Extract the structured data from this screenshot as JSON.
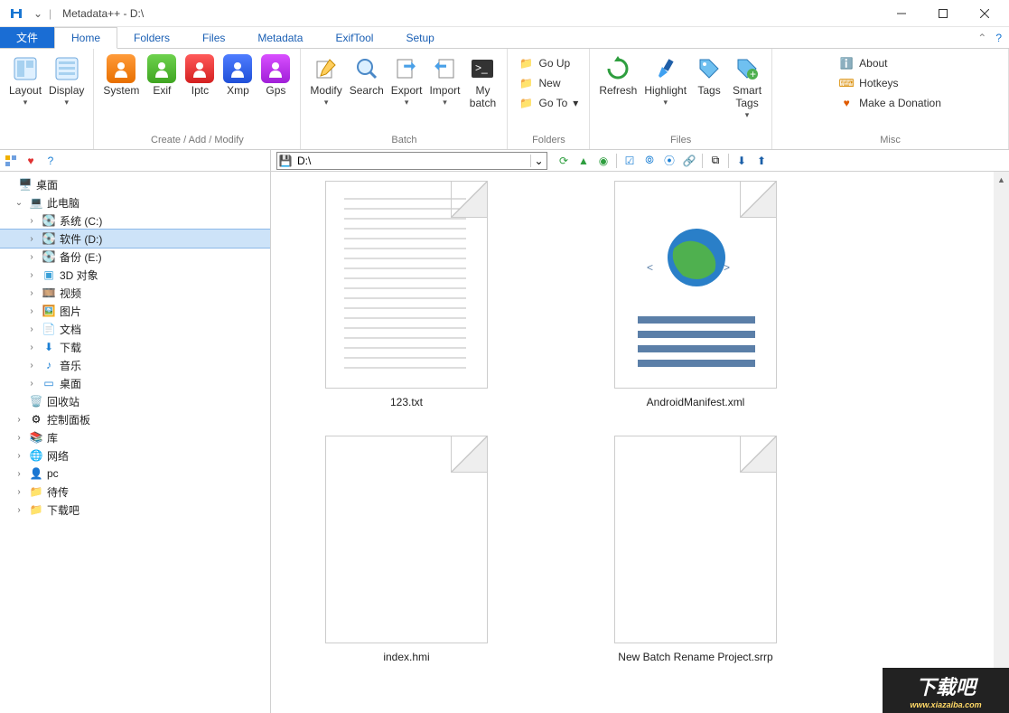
{
  "title": "Metadata++ - D:\\",
  "tabs": {
    "file": "文件",
    "home": "Home",
    "folders": "Folders",
    "files": "Files",
    "metadata": "Metadata",
    "exiftool": "ExifTool",
    "setup": "Setup"
  },
  "ribbon": {
    "g0": {
      "layout": "Layout",
      "display": "Display"
    },
    "g1": {
      "label": "Create / Add / Modify",
      "system": "System",
      "exif": "Exif",
      "iptc": "Iptc",
      "xmp": "Xmp",
      "gps": "Gps"
    },
    "g2": {
      "label": "Batch",
      "modify": "Modify",
      "search": "Search",
      "export": "Export",
      "import": "Import",
      "mybatch": "My\nbatch"
    },
    "g3": {
      "label": "Folders",
      "goup": "Go Up",
      "new": "New",
      "goto": "Go To"
    },
    "g4": {
      "label": "Files",
      "refresh": "Refresh",
      "highlight": "Highlight",
      "tags": "Tags",
      "smarttags": "Smart\nTags"
    },
    "g5": {
      "label": "Misc",
      "about": "About",
      "hotkeys": "Hotkeys",
      "donate": "Make a Donation"
    }
  },
  "path": "D:\\",
  "tree": {
    "desktop": "桌面",
    "thispc": "此电脑",
    "drives": {
      "c": "系统 (C:)",
      "d": "软件 (D:)",
      "e": "备份 (E:)"
    },
    "folders": {
      "obj3d": "3D 对象",
      "video": "视频",
      "pics": "图片",
      "docs": "文档",
      "downloads": "下载",
      "music": "音乐",
      "desk2": "桌面"
    },
    "misc": {
      "recycle": "回收站",
      "control": "控制面板",
      "lib": "库",
      "net": "网络",
      "pc": "pc",
      "pending": "待传",
      "xzb": "下载吧"
    }
  },
  "files": [
    {
      "name": "123.txt",
      "kind": "text"
    },
    {
      "name": "AndroidManifest.xml",
      "kind": "xml"
    },
    {
      "name": "index.hmi",
      "kind": "blank"
    },
    {
      "name": "New Batch Rename Project.srrp",
      "kind": "blank"
    }
  ],
  "watermark": {
    "big": "下载吧",
    "small": "www.xiazaiba.com"
  }
}
